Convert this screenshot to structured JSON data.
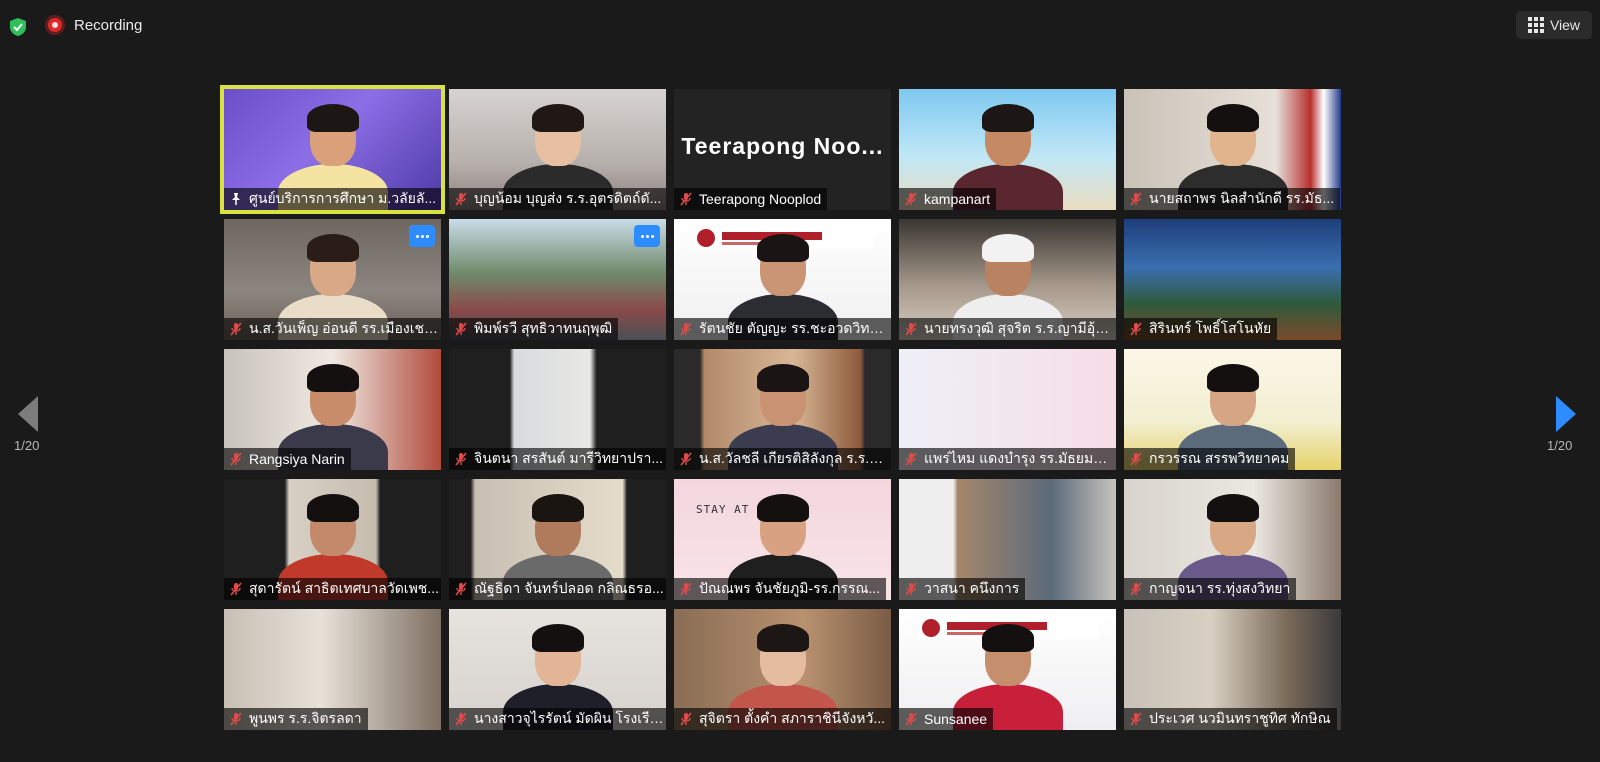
{
  "toolbar": {
    "recording_label": "Recording",
    "view_label": "View",
    "accent": "#2d8cff",
    "shield_color": "#2fbf5a",
    "record_color": "#e02828"
  },
  "pagination": {
    "left_page": "1/20",
    "right_page": "1/20"
  },
  "participants": [
    {
      "name": "ศูนย์บริการการศึกษา ม.วลัยลั...",
      "icon": "pin-icon",
      "active": true,
      "scene": "stage"
    },
    {
      "name": "บุญน้อม บุญส่ง ร.ร.อุตรดิตถ์ดั...",
      "icon": "mic-muted-icon",
      "scene": "office"
    },
    {
      "name": "Teerapong Nooplod",
      "icon": "mic-muted-icon",
      "scene": "nameonly",
      "display": "Teerapong Noo..."
    },
    {
      "name": "kampanart",
      "icon": "mic-muted-icon",
      "scene": "beach"
    },
    {
      "name": "นายสถาพร นิลสำนักดี รร.มัธ...",
      "icon": "mic-muted-icon",
      "scene": "flag"
    },
    {
      "name": "น.ส.วันเพ็ญ อ่อนดี รร.เมืองเชลี...",
      "icon": "mic-muted-icon",
      "scene": "room",
      "more": true
    },
    {
      "name": "พิมพ์รวี สุทธิวาทนฤพุฒิ",
      "icon": "mic-muted-icon",
      "scene": "town",
      "more": true
    },
    {
      "name": "รัตนชัย ตัญญะ รร.ชะอวดวิทย...",
      "icon": "mic-muted-icon",
      "scene": "banner"
    },
    {
      "name": "นายทรงวุฒิ สุจริต ร.ร.ญามีอุ้ล...",
      "icon": "mic-muted-icon",
      "scene": "tv"
    },
    {
      "name": "สิรินทร์ โพธิ์โสโนหัย",
      "icon": "mic-muted-icon",
      "scene": "temple"
    },
    {
      "name": "Rangsiya Narin",
      "icon": "mic-muted-icon",
      "scene": "window"
    },
    {
      "name": "จินตนา สรสันต์ มารีวิทยาปรา...",
      "icon": "mic-muted-icon",
      "scene": "door"
    },
    {
      "name": "น.ส.วัลชลี เกียรติสิลังกุล ร.ร.ปั...",
      "icon": "mic-muted-icon",
      "scene": "curtain"
    },
    {
      "name": "แพร่ไหม แดงบำรุง รร.มัธยมวัด...",
      "icon": "mic-muted-icon",
      "scene": "pink"
    },
    {
      "name": "กรวรรณ สรรพวิทยาคม",
      "icon": "mic-muted-icon",
      "scene": "flowers"
    },
    {
      "name": "สุดารัตน์ สาธิตเทศบาลวัดเพช...",
      "icon": "mic-muted-icon",
      "scene": "drape"
    },
    {
      "name": "ณัฐธิดา จันทร์ปลอด กลิณธรอ...",
      "icon": "mic-muted-icon",
      "scene": "hanger"
    },
    {
      "name": "ปัณณพร จันชัยภูมิ-รร.กรรณ...",
      "icon": "mic-muted-icon",
      "scene": "stayhome",
      "bg_text": "STAY AT HOME"
    },
    {
      "name": "วาสนา คนึงการ",
      "icon": "mic-muted-icon",
      "scene": "classroom"
    },
    {
      "name": "กาญจนา รร.ทุ่งสงวิทยา",
      "icon": "mic-muted-icon",
      "scene": "wall"
    },
    {
      "name": "พูนพร ร.ร.จิตรลดา",
      "icon": "mic-muted-icon",
      "scene": "empty"
    },
    {
      "name": "นางสาวจุไรรัตน์ มัดผิน โรงเรีย...",
      "icon": "mic-muted-icon",
      "scene": "plain"
    },
    {
      "name": "สุจิตรา ตั้งคำ สภาราชินีจังหวั...",
      "icon": "mic-muted-icon",
      "scene": "headset"
    },
    {
      "name": "Sunsanee",
      "icon": "mic-muted-icon",
      "scene": "banner2"
    },
    {
      "name": "ประเวศ นวมินทราชูทิศ ทักษิณ",
      "icon": "mic-muted-icon",
      "scene": "shelf"
    }
  ]
}
